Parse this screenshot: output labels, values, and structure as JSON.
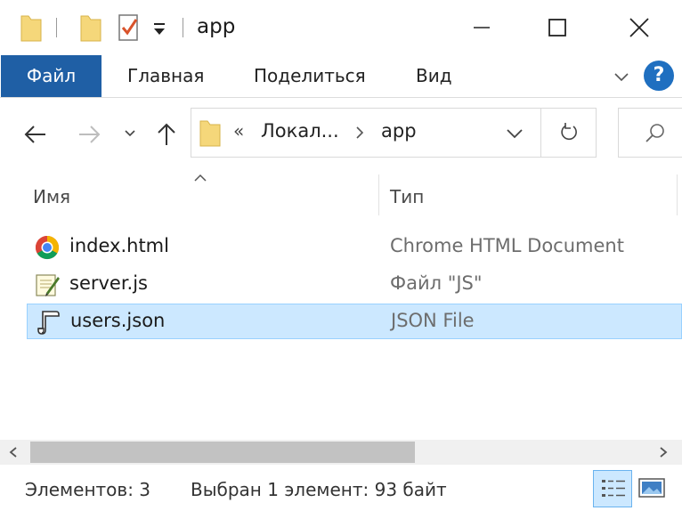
{
  "titlebar": {
    "title": "app",
    "controls": [
      "minimize",
      "maximize",
      "close"
    ]
  },
  "ribbon": {
    "tabs": [
      "Файл",
      "Главная",
      "Поделиться",
      "Вид"
    ],
    "help_label": "?"
  },
  "navigation": {
    "back_icon": "arrow-left-icon",
    "forward_icon": "arrow-right-icon",
    "recent_icon": "chevron-down-icon",
    "up_icon": "arrow-up-icon",
    "address": {
      "overflow": "«",
      "segments": [
        "Локал...",
        "app"
      ]
    }
  },
  "columns": {
    "name": "Имя",
    "type": "Тип"
  },
  "files": [
    {
      "name": "index.html",
      "type": "Chrome HTML Document",
      "icon": "chrome-icon",
      "selected": false
    },
    {
      "name": "server.js",
      "type": "Файл \"JS\"",
      "icon": "js-script-icon",
      "selected": false
    },
    {
      "name": "users.json",
      "type": "JSON File",
      "icon": "json-file-icon",
      "selected": true
    }
  ],
  "statusbar": {
    "count": "Элементов: 3",
    "selection": "Выбран 1 элемент: 93 байт"
  },
  "colors": {
    "file_tab": "#1f5fa5",
    "selection_bg": "#cce8ff",
    "selection_border": "#99d1ff",
    "help": "#1f6fc0",
    "folder": "#f5d77a"
  }
}
